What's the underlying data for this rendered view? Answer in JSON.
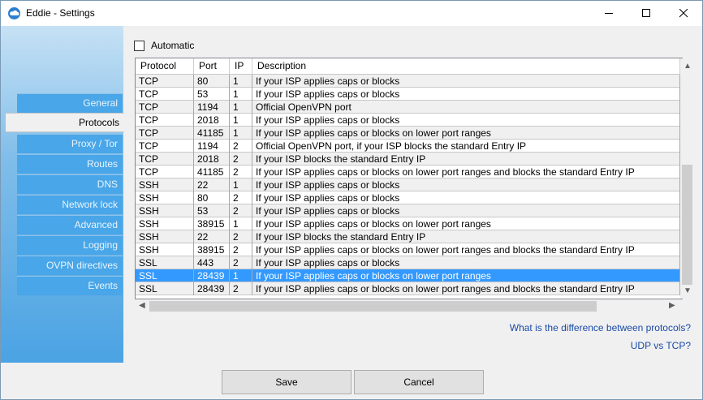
{
  "window": {
    "title": "Eddie - Settings"
  },
  "sidebar": {
    "items": [
      {
        "label": "General"
      },
      {
        "label": "Protocols",
        "active": true
      },
      {
        "label": "Proxy / Tor"
      },
      {
        "label": "Routes"
      },
      {
        "label": "DNS"
      },
      {
        "label": "Network lock"
      },
      {
        "label": "Advanced"
      },
      {
        "label": "Logging"
      },
      {
        "label": "OVPN directives"
      },
      {
        "label": "Events"
      }
    ]
  },
  "automatic": {
    "label": "Automatic",
    "checked": false
  },
  "table": {
    "columns": [
      "Protocol",
      "Port",
      "IP",
      "Description"
    ],
    "rows": [
      [
        "TCP",
        "80",
        "1",
        "If your ISP applies caps or blocks"
      ],
      [
        "TCP",
        "53",
        "1",
        "If your ISP applies caps or blocks"
      ],
      [
        "TCP",
        "1194",
        "1",
        "Official OpenVPN port"
      ],
      [
        "TCP",
        "2018",
        "1",
        "If your ISP applies caps or blocks"
      ],
      [
        "TCP",
        "41185",
        "1",
        "If your ISP applies caps or blocks on lower port ranges"
      ],
      [
        "TCP",
        "1194",
        "2",
        "Official OpenVPN port, if your ISP blocks the standard Entry IP"
      ],
      [
        "TCP",
        "2018",
        "2",
        "If your ISP blocks the standard Entry IP"
      ],
      [
        "TCP",
        "41185",
        "2",
        "If your ISP applies caps or blocks on lower port ranges and blocks the standard Entry IP"
      ],
      [
        "SSH",
        "22",
        "1",
        "If your ISP applies caps or blocks"
      ],
      [
        "SSH",
        "80",
        "2",
        "If your ISP applies caps or blocks"
      ],
      [
        "SSH",
        "53",
        "2",
        "If your ISP applies caps or blocks"
      ],
      [
        "SSH",
        "38915",
        "1",
        "If your ISP applies caps or blocks on lower port ranges"
      ],
      [
        "SSH",
        "22",
        "2",
        "If your ISP blocks the standard Entry IP"
      ],
      [
        "SSH",
        "38915",
        "2",
        "If your ISP applies caps or blocks on lower port ranges and blocks the standard Entry IP"
      ],
      [
        "SSL",
        "443",
        "2",
        "If your ISP applies caps or blocks"
      ],
      [
        "SSL",
        "28439",
        "1",
        "If your ISP applies caps or blocks on lower port ranges"
      ],
      [
        "SSL",
        "28439",
        "2",
        "If your ISP applies caps or blocks on lower port ranges and blocks the standard Entry IP"
      ]
    ],
    "selected_index": 15
  },
  "links": {
    "protocol_difference": "What is the difference between protocols?",
    "udp_vs_tcp": "UDP vs TCP?"
  },
  "buttons": {
    "save": "Save",
    "cancel": "Cancel"
  },
  "colors": {
    "accent": "#3399ff",
    "sidebar": "#49a6e8",
    "link": "#1a4aa8"
  },
  "icons": {
    "app": "cloud-icon",
    "minimize": "minimize-icon",
    "maximize": "maximize-icon",
    "close": "close-icon"
  }
}
